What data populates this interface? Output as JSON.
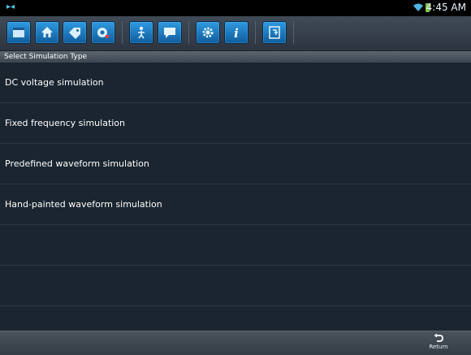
{
  "status_bar": {
    "time": "4:45 AM",
    "icons": [
      "notification-icon",
      "wifi-icon",
      "battery-icon"
    ]
  },
  "toolbar": {
    "buttons": [
      {
        "icon": "window-icon"
      },
      {
        "icon": "home-icon"
      },
      {
        "icon": "tag-icon"
      },
      {
        "icon": "car-settings-icon"
      },
      {
        "icon": "person-icon"
      },
      {
        "icon": "chat-icon"
      },
      {
        "icon": "gear-icon"
      },
      {
        "icon": "info-icon"
      },
      {
        "icon": "exit-icon"
      }
    ]
  },
  "header": {
    "title": "Select Simulation Type"
  },
  "list": {
    "items": [
      {
        "label": "DC voltage simulation"
      },
      {
        "label": "Fixed frequency simulation"
      },
      {
        "label": "Predefined waveform simulation"
      },
      {
        "label": "Hand-painted waveform simulation"
      },
      {
        "label": ""
      },
      {
        "label": ""
      }
    ]
  },
  "bottom_bar": {
    "return_label": "Return"
  },
  "colors": {
    "accent": "#1f7fc8",
    "background": "#1b2530"
  }
}
